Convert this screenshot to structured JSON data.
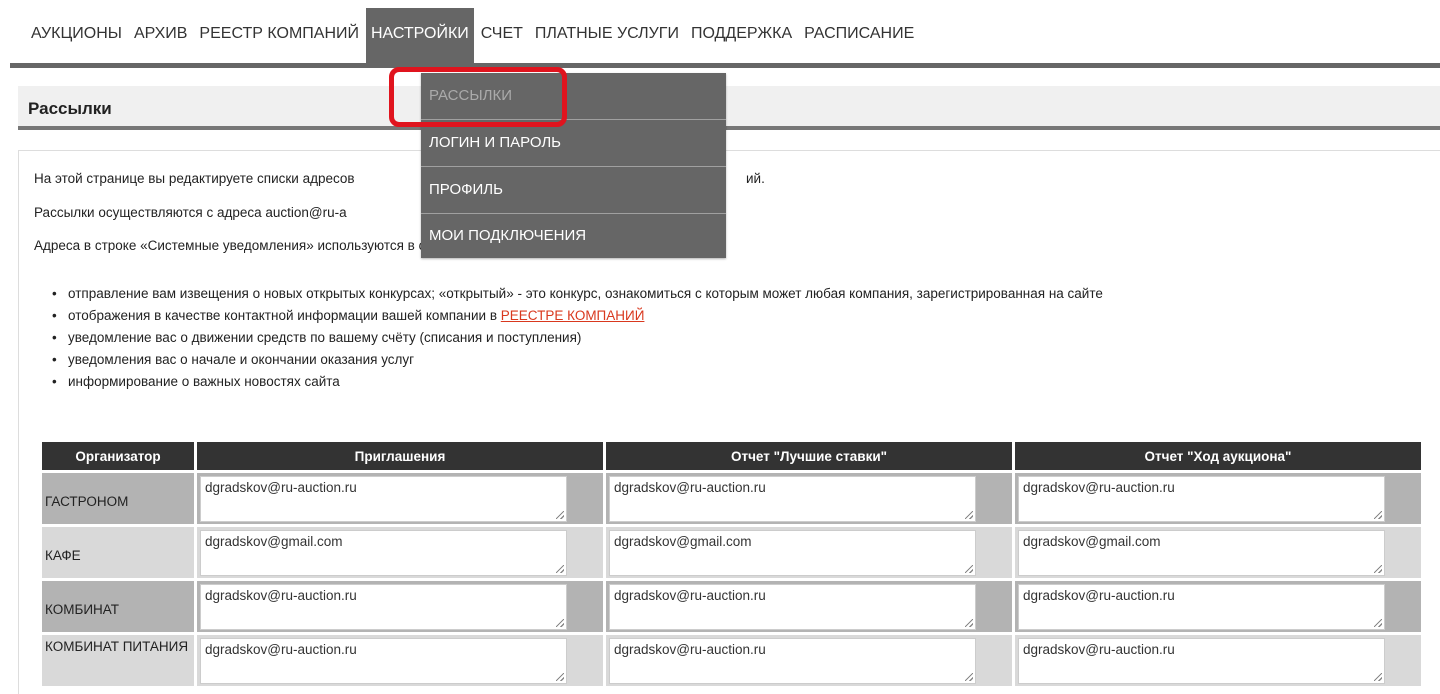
{
  "nav": {
    "items": [
      "АУКЦИОНЫ",
      "АРХИВ",
      "РЕЕСТР КОМПАНИЙ",
      "НАСТРОЙКИ",
      "СЧЕТ",
      "ПЛАТНЫЕ УСЛУГИ",
      "ПОДДЕРЖКА",
      "РАСПИСАНИЕ"
    ],
    "active": "НАСТРОЙКИ"
  },
  "dropdown": {
    "items": [
      "РАССЫЛКИ",
      "ЛОГИН И ПАРОЛЬ",
      "ПРОФИЛЬ",
      "МОИ ПОДКЛЮЧЕНИЯ"
    ]
  },
  "page": {
    "title": "Рассылки"
  },
  "intro": {
    "p1": "На этой странице вы редактируете списки адресов",
    "p1_tail": "ий.",
    "p2": "Рассылки осуществляются с адреса auction@ru-a",
    "p3": "Адреса в строке «Системные уведомления» используются в следующих случаях:"
  },
  "bullets": {
    "b1": "отправление вам извещения о новых открытых конкурсах; «открытый» - это конкурс, ознакомиться с которым может любая компания, зарегистрированная на сайте",
    "b2": "отображения в качестве контактной информации вашей компании в",
    "b2_link": "РЕЕСТРЕ КОМПАНИЙ",
    "b3": "уведомление вас о движении средств по вашему счёту (списания и поступления)",
    "b4": "уведомления вас о начале и окончании оказания услуг",
    "b5": "информирование о важных новостях сайта"
  },
  "table": {
    "headers": [
      "Организатор",
      "Приглашения",
      "Отчет \"Лучшие ставки\"",
      "Отчет \"Ход аукциона\""
    ],
    "rows": [
      {
        "org": "ГАСТРОНОМ",
        "inv": "dgradskov@ru-auction.ru",
        "best": "dgradskov@ru-auction.ru",
        "prog": "dgradskov@ru-auction.ru"
      },
      {
        "org": "КАФЕ",
        "inv": "dgradskov@gmail.com",
        "best": "dgradskov@gmail.com",
        "prog": "dgradskov@gmail.com"
      },
      {
        "org": "КОМБИНАТ",
        "inv": "dgradskov@ru-auction.ru",
        "best": "dgradskov@ru-auction.ru",
        "prog": "dgradskov@ru-auction.ru"
      },
      {
        "org": "КОМБИНАТ ПИТАНИЯ",
        "inv": "dgradskov@ru-auction.ru",
        "best": "dgradskov@ru-auction.ru",
        "prog": "dgradskov@ru-auction.ru"
      }
    ]
  },
  "colors": {
    "nav_active": "#666666",
    "header_dark": "#333333",
    "highlight": "#e0141e",
    "link": "#d9381e"
  }
}
